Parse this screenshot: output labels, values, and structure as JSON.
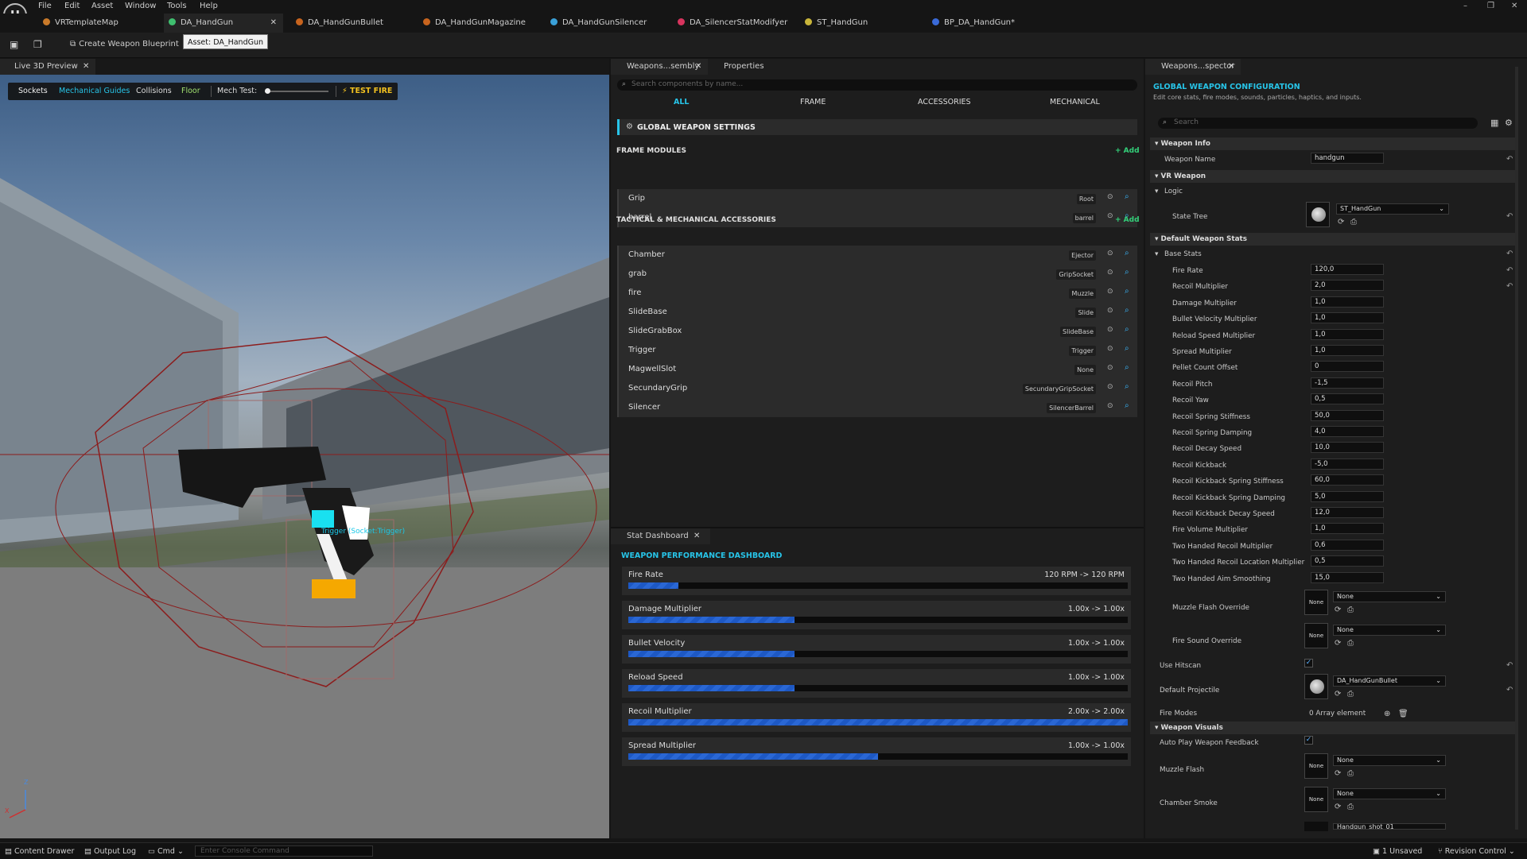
{
  "menu": {
    "items": [
      "File",
      "Edit",
      "Asset",
      "Window",
      "Tools",
      "Help"
    ]
  },
  "tabs": [
    {
      "label": "VRTemplateMap",
      "color": "#c97a2a"
    },
    {
      "label": "DA_HandGun",
      "color": "#3fbf6f",
      "active": true
    },
    {
      "label": "DA_HandGunBullet",
      "color": "#c8641e"
    },
    {
      "label": "DA_HandGunMagazine",
      "color": "#c8641e"
    },
    {
      "label": "DA_HandGunSilencer",
      "color": "#3aa0d8"
    },
    {
      "label": "DA_SilencerStatModifyer",
      "color": "#d8345e"
    },
    {
      "label": "ST_HandGun",
      "color": "#c9b53a"
    },
    {
      "label": "BP_DA_HandGun*",
      "color": "#3a6ad8"
    }
  ],
  "toolbar": {
    "create_label": "Create Weapon Blueprint",
    "tooltip": "Asset: DA_HandGun"
  },
  "viewport": {
    "tab": "Live 3D Preview",
    "buttons": [
      "Sockets",
      "Mechanical Guides",
      "Collisions",
      "Floor"
    ],
    "mech_test_label": "Mech Test:",
    "test_fire_label": "TEST FIRE",
    "overlay_label": "Trigger (Socket:Trigger)",
    "axis_x": "X",
    "axis_z": "Z"
  },
  "assembly": {
    "tabs": [
      "Weapons...sembly",
      "Properties"
    ],
    "search_placeholder": "Search components by name...",
    "filters": [
      "ALL",
      "FRAME",
      "ACCESSORIES",
      "MECHANICAL"
    ],
    "global_label": "GLOBAL WEAPON SETTINGS",
    "frame_header": "FRAME MODULES",
    "add_label": "+ Add",
    "frame_items": [
      {
        "name": "Grip",
        "tag": "Root"
      },
      {
        "name": "barrel",
        "tag": "barrel"
      }
    ],
    "acc_header": "TACTICAL & MECHANICAL ACCESSORIES",
    "acc_items": [
      {
        "name": "Chamber",
        "tag": "Ejector"
      },
      {
        "name": "grab",
        "tag": "GripSocket"
      },
      {
        "name": "fire",
        "tag": "Muzzle"
      },
      {
        "name": "SlideBase",
        "tag": "Slide"
      },
      {
        "name": "SlideGrabBox",
        "tag": "SlideBase"
      },
      {
        "name": "Trigger",
        "tag": "Trigger"
      },
      {
        "name": "MagwellSlot",
        "tag": "None"
      },
      {
        "name": "SecundaryGrip",
        "tag": "SecundaryGripSocket"
      },
      {
        "name": "Silencer",
        "tag": "SilencerBarrel"
      }
    ]
  },
  "stats": {
    "tab": "Stat Dashboard",
    "title": "WEAPON PERFORMANCE DASHBOARD",
    "items": [
      {
        "label": "Fire Rate",
        "value": "120 RPM -> 120 RPM",
        "fill": 0.1
      },
      {
        "label": "Damage Multiplier",
        "value": "1.00x -> 1.00x",
        "fill": 0.333
      },
      {
        "label": "Bullet Velocity",
        "value": "1.00x -> 1.00x",
        "fill": 0.333
      },
      {
        "label": "Reload Speed",
        "value": "1.00x -> 1.00x",
        "fill": 0.333
      },
      {
        "label": "Recoil Multiplier",
        "value": "2.00x -> 2.00x",
        "fill": 1.0
      },
      {
        "label": "Spread Multiplier",
        "value": "1.00x -> 1.00x",
        "fill": 0.5
      }
    ]
  },
  "inspector": {
    "tab": "Weapons...spector",
    "title": "GLOBAL WEAPON CONFIGURATION",
    "subtitle": "Edit core stats, fire modes, sounds, particles, haptics, and inputs.",
    "search_placeholder": "Search",
    "cat_weapon_info": "Weapon Info",
    "weapon_name_label": "Weapon Name",
    "weapon_name_value": "handgun",
    "cat_vr": "VR Weapon",
    "logic_label": "Logic",
    "state_tree_label": "State Tree",
    "state_tree_value": "ST_HandGun",
    "cat_default_stats": "Default Weapon Stats",
    "base_stats_label": "Base Stats",
    "base_stats": [
      {
        "label": "Fire Rate",
        "value": "120,0"
      },
      {
        "label": "Recoil Multiplier",
        "value": "2,0"
      },
      {
        "label": "Damage Multiplier",
        "value": "1,0"
      },
      {
        "label": "Bullet Velocity Multiplier",
        "value": "1,0"
      },
      {
        "label": "Reload Speed Multiplier",
        "value": "1,0"
      },
      {
        "label": "Spread Multiplier",
        "value": "1,0"
      },
      {
        "label": "Pellet Count Offset",
        "value": "0"
      },
      {
        "label": "Recoil Pitch",
        "value": "-1,5"
      },
      {
        "label": "Recoil Yaw",
        "value": "0,5"
      },
      {
        "label": "Recoil Spring Stiffness",
        "value": "50,0"
      },
      {
        "label": "Recoil Spring Damping",
        "value": "4,0"
      },
      {
        "label": "Recoil Decay Speed",
        "value": "10,0"
      },
      {
        "label": "Recoil Kickback",
        "value": "-5,0"
      },
      {
        "label": "Recoil Kickback Spring Stiffness",
        "value": "60,0"
      },
      {
        "label": "Recoil Kickback Spring Damping",
        "value": "5,0"
      },
      {
        "label": "Recoil Kickback Decay Speed",
        "value": "12,0"
      },
      {
        "label": "Fire Volume Multiplier",
        "value": "1,0"
      },
      {
        "label": "Two Handed Recoil Multiplier",
        "value": "0,6"
      },
      {
        "label": "Two Handed Recoil Location Multiplier",
        "value": "0,5"
      },
      {
        "label": "Two Handed Aim Smoothing",
        "value": "15,0"
      }
    ],
    "muzzle_flash_override_label": "Muzzle Flash Override",
    "fire_sound_override_label": "Fire Sound Override",
    "none_label": "None",
    "use_hitscan_label": "Use Hitscan",
    "default_projectile_label": "Default Projectile",
    "default_projectile_value": "DA_HandGunBullet",
    "fire_modes_label": "Fire Modes",
    "fire_modes_value": "0 Array element",
    "cat_visuals": "Weapon Visuals",
    "auto_play_label": "Auto Play Weapon Feedback",
    "muzzle_flash_label": "Muzzle Flash",
    "chamber_smoke_label": "Chamber Smoke",
    "partial_value": "Handgun_shot_01"
  },
  "status": {
    "content_drawer": "Content Drawer",
    "output_log": "Output Log",
    "cmd": "Cmd",
    "console_placeholder": "Enter Console Command",
    "unsaved": "1 Unsaved",
    "revision": "Revision Control"
  },
  "colors": {
    "accent_cyan": "#27c4e8",
    "add_green": "#33d17a",
    "bar_blue": "#1d58c4"
  }
}
